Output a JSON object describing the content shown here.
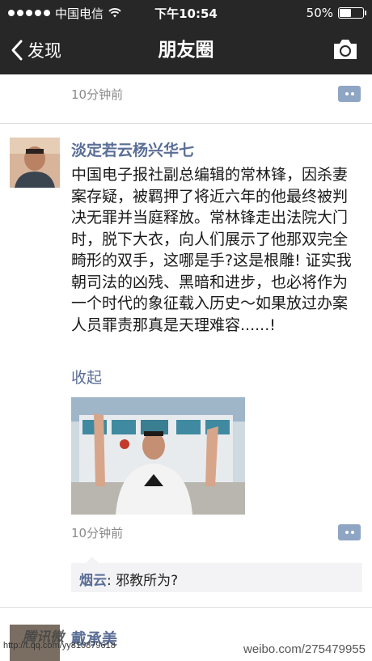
{
  "status_bar": {
    "carrier": "中国电信",
    "time": "下午10:54",
    "battery_text": "50%",
    "battery_level": 0.5
  },
  "nav": {
    "back_label": "发现",
    "title": "朋友圈"
  },
  "feed": {
    "prev_post_time": "10分钟前",
    "post": {
      "author": "淡定若云杨兴华七",
      "text": "中国电子报社副总编辑的常林锋，因杀妻案存疑，被羁押了将近六年的他最终被判决无罪并当庭释放。常林锋走出法院大门时，脱下大衣，向人们展示了他那双完全畸形的双手，这哪是手?这是根雕! 证实我朝司法的凶残、黑暗和进步，也必将作为一个时代的象征载入历史～如果放过办案人员罪责那真是天理难容......!",
      "collapse_label": "收起",
      "time": "10分钟前",
      "comments": [
        {
          "user": "烟云",
          "text": "邪教所为?"
        }
      ]
    },
    "next_post": {
      "author": "戴承美"
    }
  },
  "watermarks": {
    "left_logo": "腾讯微",
    "left_url": "http://t.qq.com/yy810879618",
    "right_url": "weibo.com/275479955"
  }
}
